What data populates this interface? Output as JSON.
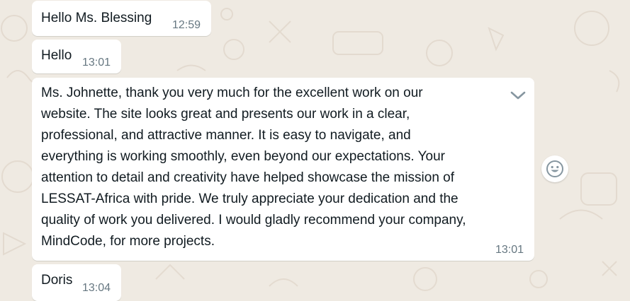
{
  "chat": {
    "background_color": "#efeae2",
    "messages": [
      {
        "text": "Hello Ms. Blessing",
        "time": "12:59"
      },
      {
        "text": "Hello",
        "time": "13:01"
      },
      {
        "lines": [
          "Ms. Johnette, thank you very much for the excellent work on our",
          "website. The site looks great and presents our work in a clear,",
          "professional, and attractive manner. It is easy to navigate, and",
          "everything is working smoothly, even beyond our expectations. Your",
          "attention to detail and creativity have helped showcase the mission of",
          "LESSAT-Africa with pride. We truly appreciate your dedication and the",
          "quality of work you delivered. I would gladly recommend your company,",
          "MindCode, for more projects."
        ],
        "time": "13:01"
      },
      {
        "text": "Doris",
        "time": "13:04"
      }
    ],
    "icons": {
      "menu": "chevron-down-icon",
      "reaction": "smiley-icon"
    }
  }
}
